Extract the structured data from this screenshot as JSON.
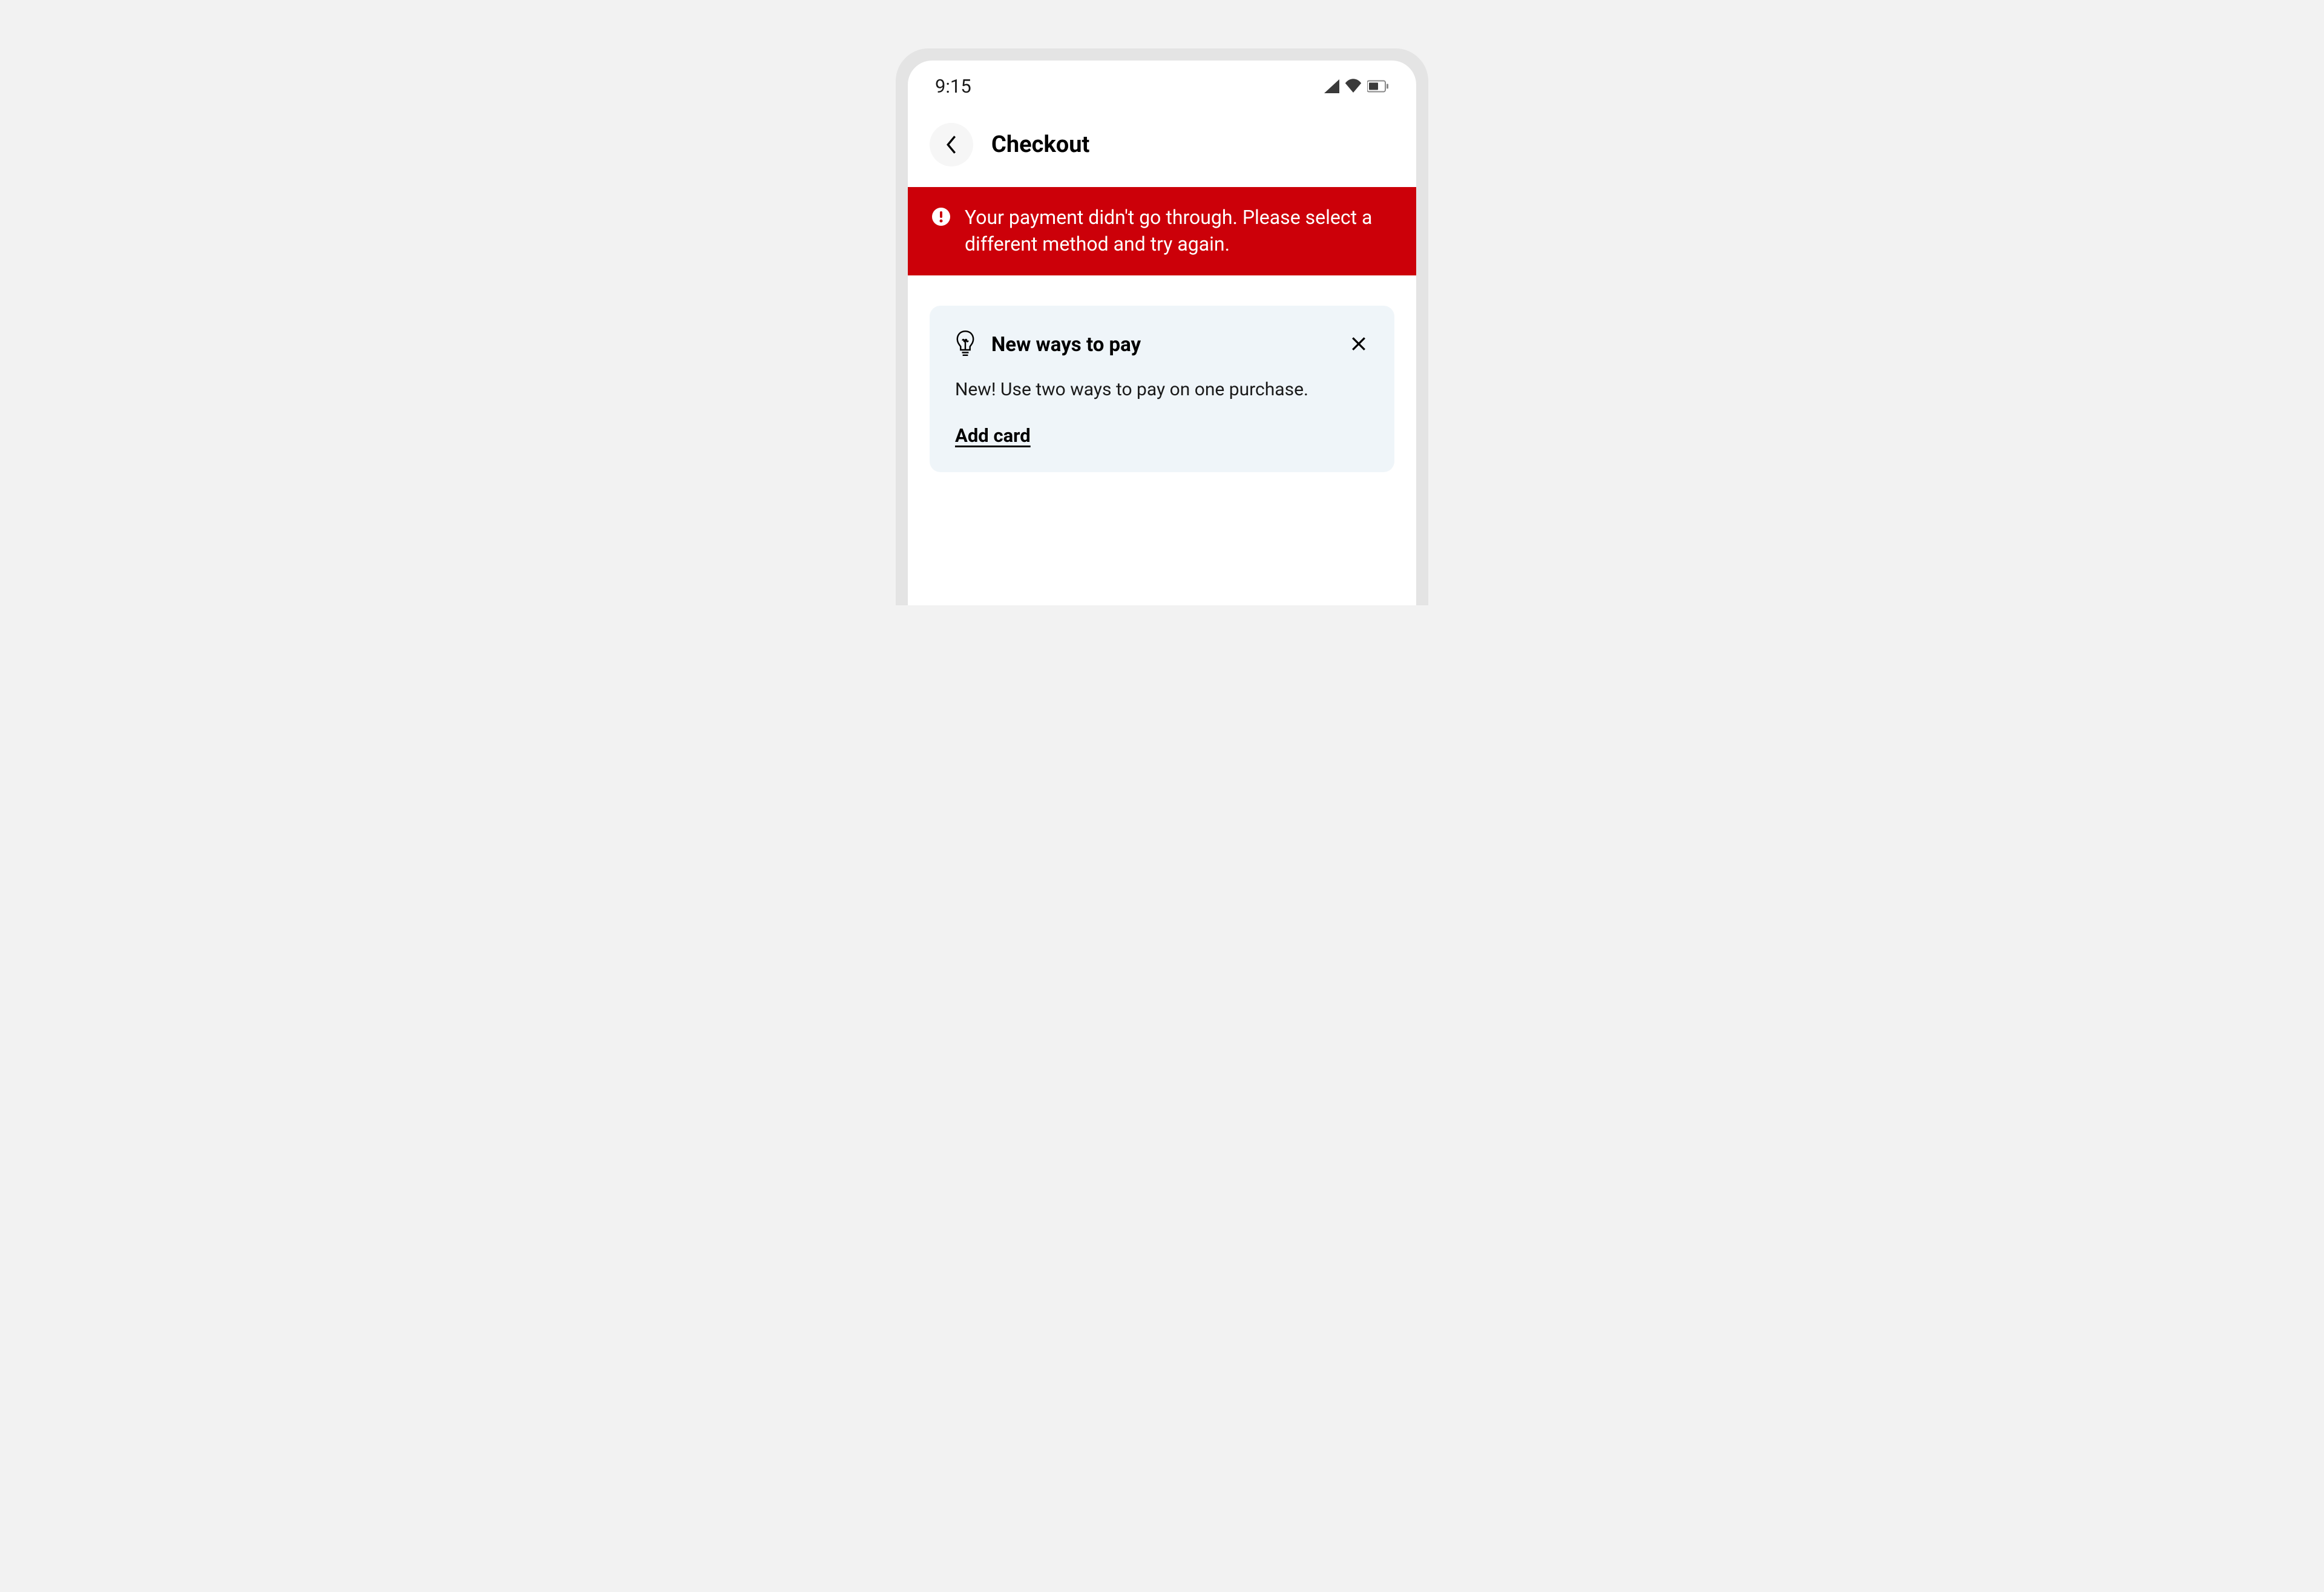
{
  "status_bar": {
    "time": "9:15"
  },
  "header": {
    "title": "Checkout"
  },
  "error_banner": {
    "message": "Your payment didn't go through. Please select a different method and try again."
  },
  "info_card": {
    "title": "New ways to pay",
    "body": "New! Use two ways to pay on one purchase.",
    "action_label": "Add card"
  }
}
